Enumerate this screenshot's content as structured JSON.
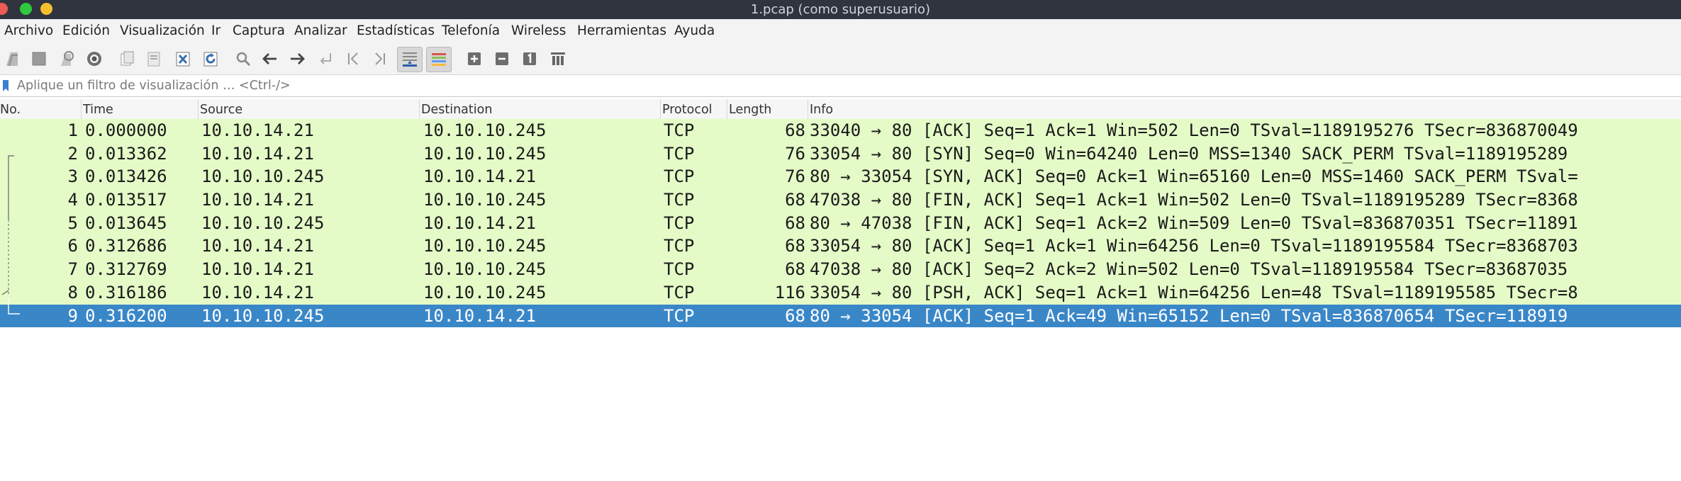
{
  "window": {
    "title": "1.pcap (como superusuario)",
    "controls": [
      {
        "name": "close",
        "color": "#ed5c54"
      },
      {
        "name": "maximize",
        "color": "#2fc940"
      },
      {
        "name": "minimize",
        "color": "#f5bf2e"
      }
    ]
  },
  "menu": [
    "Archivo",
    "Edición",
    "Visualización",
    "Ir",
    "Captura",
    "Analizar",
    "Estadísticas",
    "Telefonía",
    "Wireless",
    "Herramientas",
    "Ayuda"
  ],
  "toolbar": [
    "start-capture-icon",
    "stop-capture-icon",
    "restart-capture-icon",
    "capture-options-icon",
    "open-file-icon",
    "save-file-icon",
    "close-file-icon",
    "reload-file-icon",
    "find-packet-icon",
    "go-back-icon",
    "go-forward-icon",
    "go-to-packet-icon",
    "first-packet-icon",
    "last-packet-icon",
    "autoscroll-icon",
    "colorize-icon",
    "zoom-in-icon",
    "zoom-out-icon",
    "normal-size-icon",
    "resize-columns-icon"
  ],
  "filter": {
    "placeholder": "Aplique un filtro de visualización … <Ctrl-/>",
    "value": ""
  },
  "columns": [
    "No.",
    "Time",
    "Source",
    "Destination",
    "Protocol",
    "Length",
    "Info"
  ],
  "packets": [
    {
      "no": "1",
      "time": "0.000000",
      "src": "10.10.14.21",
      "dst": "10.10.10.245",
      "proto": "TCP",
      "len": "68",
      "info": "33040 → 80 [ACK] Seq=1 Ack=1 Win=502 Len=0 TSval=1189195276 TSecr=836870049"
    },
    {
      "no": "2",
      "time": "0.013362",
      "src": "10.10.14.21",
      "dst": "10.10.10.245",
      "proto": "TCP",
      "len": "76",
      "info": "33054 → 80 [SYN] Seq=0 Win=64240 Len=0 MSS=1340 SACK_PERM TSval=1189195289"
    },
    {
      "no": "3",
      "time": "0.013426",
      "src": "10.10.10.245",
      "dst": "10.10.14.21",
      "proto": "TCP",
      "len": "76",
      "info": "80 → 33054 [SYN, ACK] Seq=0 Ack=1 Win=65160 Len=0 MSS=1460 SACK_PERM TSval="
    },
    {
      "no": "4",
      "time": "0.013517",
      "src": "10.10.14.21",
      "dst": "10.10.10.245",
      "proto": "TCP",
      "len": "68",
      "info": "47038 → 80 [FIN, ACK] Seq=1 Ack=1 Win=502 Len=0 TSval=1189195289 TSecr=8368"
    },
    {
      "no": "5",
      "time": "0.013645",
      "src": "10.10.10.245",
      "dst": "10.10.14.21",
      "proto": "TCP",
      "len": "68",
      "info": "80 → 47038 [FIN, ACK] Seq=1 Ack=2 Win=509 Len=0 TSval=836870351 TSecr=11891"
    },
    {
      "no": "6",
      "time": "0.312686",
      "src": "10.10.14.21",
      "dst": "10.10.10.245",
      "proto": "TCP",
      "len": "68",
      "info": "33054 → 80 [ACK] Seq=1 Ack=1 Win=64256 Len=0 TSval=1189195584 TSecr=8368703"
    },
    {
      "no": "7",
      "time": "0.312769",
      "src": "10.10.14.21",
      "dst": "10.10.10.245",
      "proto": "TCP",
      "len": "68",
      "info": "47038 → 80 [ACK] Seq=2 Ack=2 Win=502 Len=0 TSval=1189195584 TSecr=83687035"
    },
    {
      "no": "8",
      "time": "0.316186",
      "src": "10.10.14.21",
      "dst": "10.10.10.245",
      "proto": "TCP",
      "len": "116",
      "info": "33054 → 80 [PSH, ACK] Seq=1 Ack=1 Win=64256 Len=48 TSval=1189195585 TSecr=8"
    },
    {
      "no": "9",
      "time": "0.316200",
      "src": "10.10.10.245",
      "dst": "10.10.14.21",
      "proto": "TCP",
      "len": "68",
      "info": "80 → 33054 [ACK] Seq=1 Ack=49 Win=65152 Len=0 TSval=836870654 TSecr=118919",
      "selected": true
    }
  ],
  "colors": {
    "tcp_row": "#e4fbc7",
    "selected_row": "#3a87c8"
  }
}
